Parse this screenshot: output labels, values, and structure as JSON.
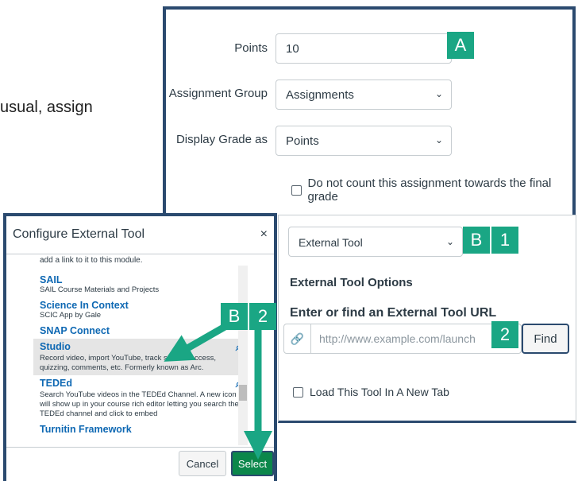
{
  "background_text": "usual, assign",
  "settings": {
    "points_label": "Points",
    "points_value": "10",
    "group_label": "Assignment Group",
    "group_value": "Assignments",
    "display_label": "Display Grade as",
    "display_value": "Points",
    "exclude_label": "Do not count this assignment towards the final grade"
  },
  "submission": {
    "type_value": "External Tool",
    "options_heading": "External Tool Options",
    "url_heading": "Enter or find an External Tool URL",
    "url_placeholder": "http://www.example.com/launch",
    "find_label": "Find",
    "new_tab_label": "Load This Tool In A New Tab"
  },
  "dialog": {
    "title": "Configure External Tool",
    "close": "×",
    "top_text": "add a link to it to this module.",
    "items": [
      {
        "title": "SAIL",
        "desc": "SAIL Course Materials and Projects"
      },
      {
        "title": "Science In Context",
        "desc": "SCIC App by Gale"
      },
      {
        "title": "SNAP Connect",
        "desc": ""
      },
      {
        "title": "Studio",
        "desc": "Record video, import YouTube, track student access, quizzing, comments, etc. Formerly known as Arc."
      },
      {
        "title": "TEDEd",
        "desc": "Search YouTube videos in the TEDEd Channel. A new icon will show up in your course rich editor letting you search the TEDEd channel and click to embed"
      },
      {
        "title": "Turnitin Framework",
        "desc": ""
      }
    ],
    "cancel_label": "Cancel",
    "select_label": "Select"
  },
  "badges": {
    "a": "A",
    "b1_letter": "B",
    "b1_num": "1",
    "b2_letter": "B",
    "b2_num": "2",
    "url_num": "2"
  },
  "colors": {
    "badge": "#1aa684",
    "border": "#2b4a6f",
    "link": "#0e68b3",
    "select": "#0b874b"
  }
}
